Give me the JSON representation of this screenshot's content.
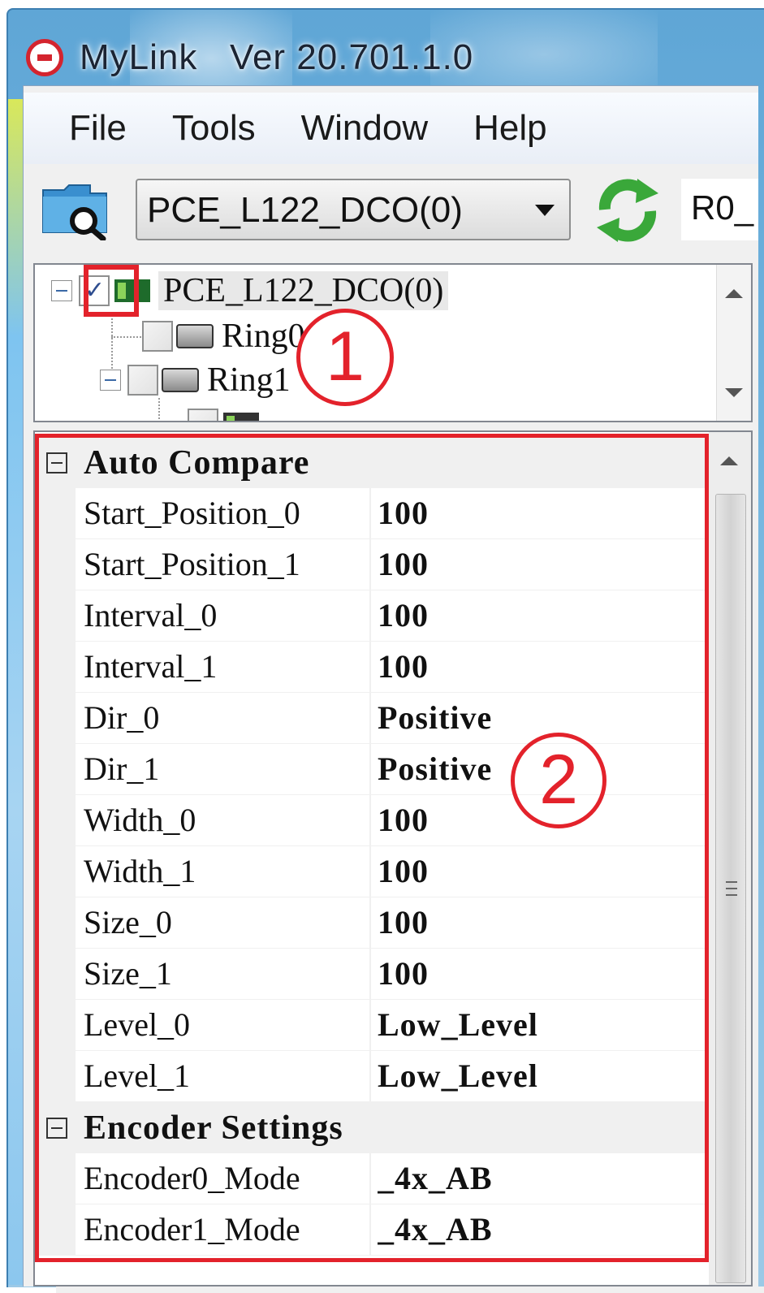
{
  "window": {
    "title": "MyLink   Ver 20.701.1.0"
  },
  "menu": [
    "File",
    "Tools",
    "Window",
    "Help"
  ],
  "toolbar": {
    "device_selected": "PCE_L122_DCO(0)",
    "ring_field": "R0_"
  },
  "tree": {
    "root": {
      "label": "PCE_L122_DCO(0)",
      "checked": true
    },
    "children": [
      {
        "label": "Ring0",
        "checked": false
      },
      {
        "label": "Ring1",
        "checked": false
      }
    ]
  },
  "annotations": {
    "marker1": "1",
    "marker2": "2"
  },
  "property_grid": {
    "categories": [
      {
        "label": "Auto Compare",
        "rows": [
          {
            "name": "Start_Position_0",
            "value": "100"
          },
          {
            "name": "Start_Position_1",
            "value": "100"
          },
          {
            "name": "Interval_0",
            "value": "100"
          },
          {
            "name": "Interval_1",
            "value": "100"
          },
          {
            "name": "Dir_0",
            "value": "Positive"
          },
          {
            "name": "Dir_1",
            "value": "Positive"
          },
          {
            "name": "Width_0",
            "value": "100"
          },
          {
            "name": "Width_1",
            "value": "100"
          },
          {
            "name": "Size_0",
            "value": "100"
          },
          {
            "name": "Size_1",
            "value": "100"
          },
          {
            "name": "Level_0",
            "value": "Low_Level"
          },
          {
            "name": "Level_1",
            "value": "Low_Level"
          }
        ]
      },
      {
        "label": "Encoder Settings",
        "rows": [
          {
            "name": "Encoder0_Mode",
            "value": "_4x_AB"
          },
          {
            "name": "Encoder1_Mode",
            "value": "_4x_AB"
          }
        ]
      }
    ]
  },
  "colors": {
    "annotation_red": "#e3222b",
    "checkmark_blue": "#2e4d8f",
    "refresh_green": "#3aa83a"
  }
}
